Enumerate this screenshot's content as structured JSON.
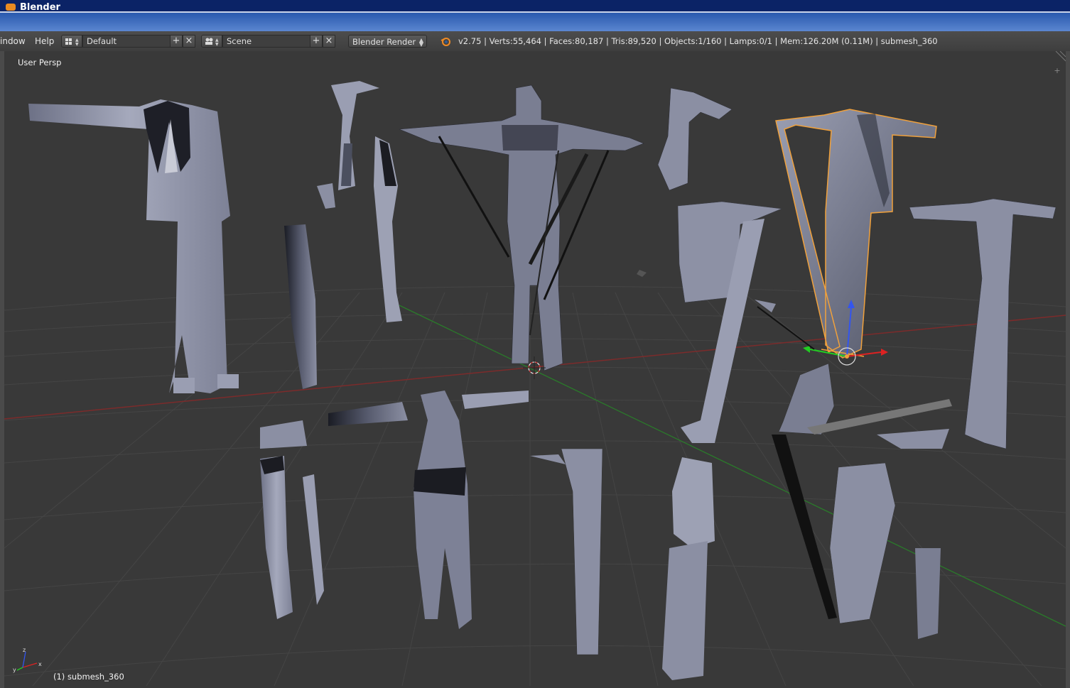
{
  "window": {
    "title": "Blender"
  },
  "menubar": {
    "menu_window": "indow",
    "menu_help": "Help",
    "screen_layout": "Default",
    "scene": "Scene",
    "render_engine": "Blender Render",
    "stats": "v2.75 | Verts:55,464 | Faces:80,187 | Tris:89,520 | Objects:1/160 | Lamps:0/1 | Mem:126.20M (0.11M) | submesh_360"
  },
  "viewport": {
    "view_label": "User Persp",
    "active_object_label": "(1) submesh_360",
    "axis_x": "x",
    "axis_y": "y",
    "axis_z": "z"
  },
  "colors": {
    "background": "#393939",
    "grid": "#4a4a4a",
    "x_axis": "#8a2a2a",
    "y_axis": "#2a7a2a",
    "selection": "#f0a13c",
    "mesh": "#8b8fa3"
  },
  "icons": [
    "blender-logo-icon",
    "screen-layout-icon",
    "scene-icon",
    "plus-icon",
    "close-icon",
    "dropdown-arrow-icon",
    "3d-cursor-icon",
    "transform-gizmo-icon",
    "axis-icon"
  ]
}
